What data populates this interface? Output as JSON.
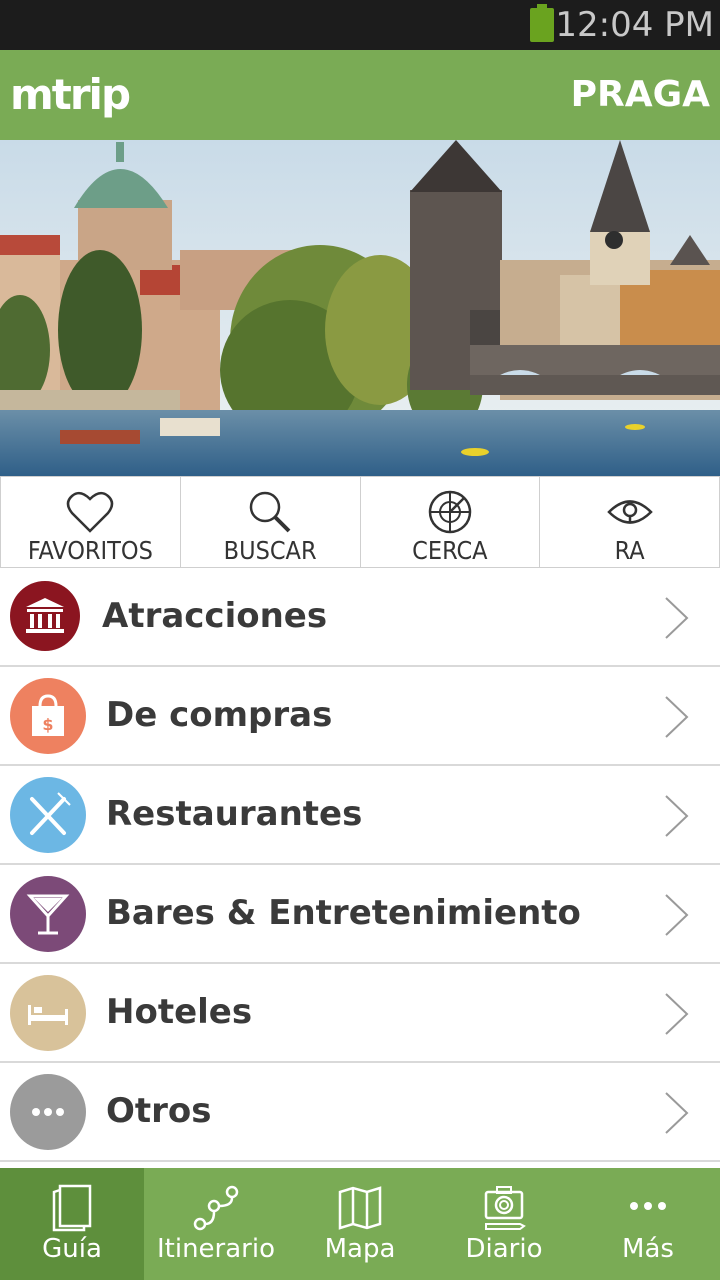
{
  "status_bar": {
    "time": "12:04 PM"
  },
  "header": {
    "logo": "mtrip",
    "city": "PRAGA"
  },
  "quick_actions": [
    {
      "label": "FAVORITOS",
      "icon": "heart-icon"
    },
    {
      "label": "BUSCAR",
      "icon": "search-icon"
    },
    {
      "label": "CERCA",
      "icon": "radar-icon"
    },
    {
      "label": "RA",
      "icon": "eye-icon"
    }
  ],
  "categories": [
    {
      "label": "Atracciones",
      "icon": "museum-icon",
      "color": "#8b1520"
    },
    {
      "label": "De compras",
      "icon": "shopping-bag-icon",
      "color": "#ee8160"
    },
    {
      "label": "Restaurantes",
      "icon": "fork-knife-icon",
      "color": "#6cb7e4"
    },
    {
      "label": "Bares & Entretenimiento",
      "icon": "cocktail-icon",
      "color": "#7c4a78"
    },
    {
      "label": "Hoteles",
      "icon": "bed-icon",
      "color": "#d8c29a"
    },
    {
      "label": "Otros",
      "icon": "more-dots-icon",
      "color": "#9b9b9b"
    }
  ],
  "tabs": [
    {
      "label": "Guía",
      "icon": "guide-book-icon",
      "active": true
    },
    {
      "label": "Itinerario",
      "icon": "route-icon",
      "active": false
    },
    {
      "label": "Mapa",
      "icon": "map-icon",
      "active": false
    },
    {
      "label": "Diario",
      "icon": "camera-icon",
      "active": false
    },
    {
      "label": "Más",
      "icon": "more-dots-icon",
      "active": false
    }
  ],
  "colors": {
    "header_green": "#7aab55",
    "active_tab": "#5e8f3c",
    "status_bar": "#1c1c1c"
  }
}
